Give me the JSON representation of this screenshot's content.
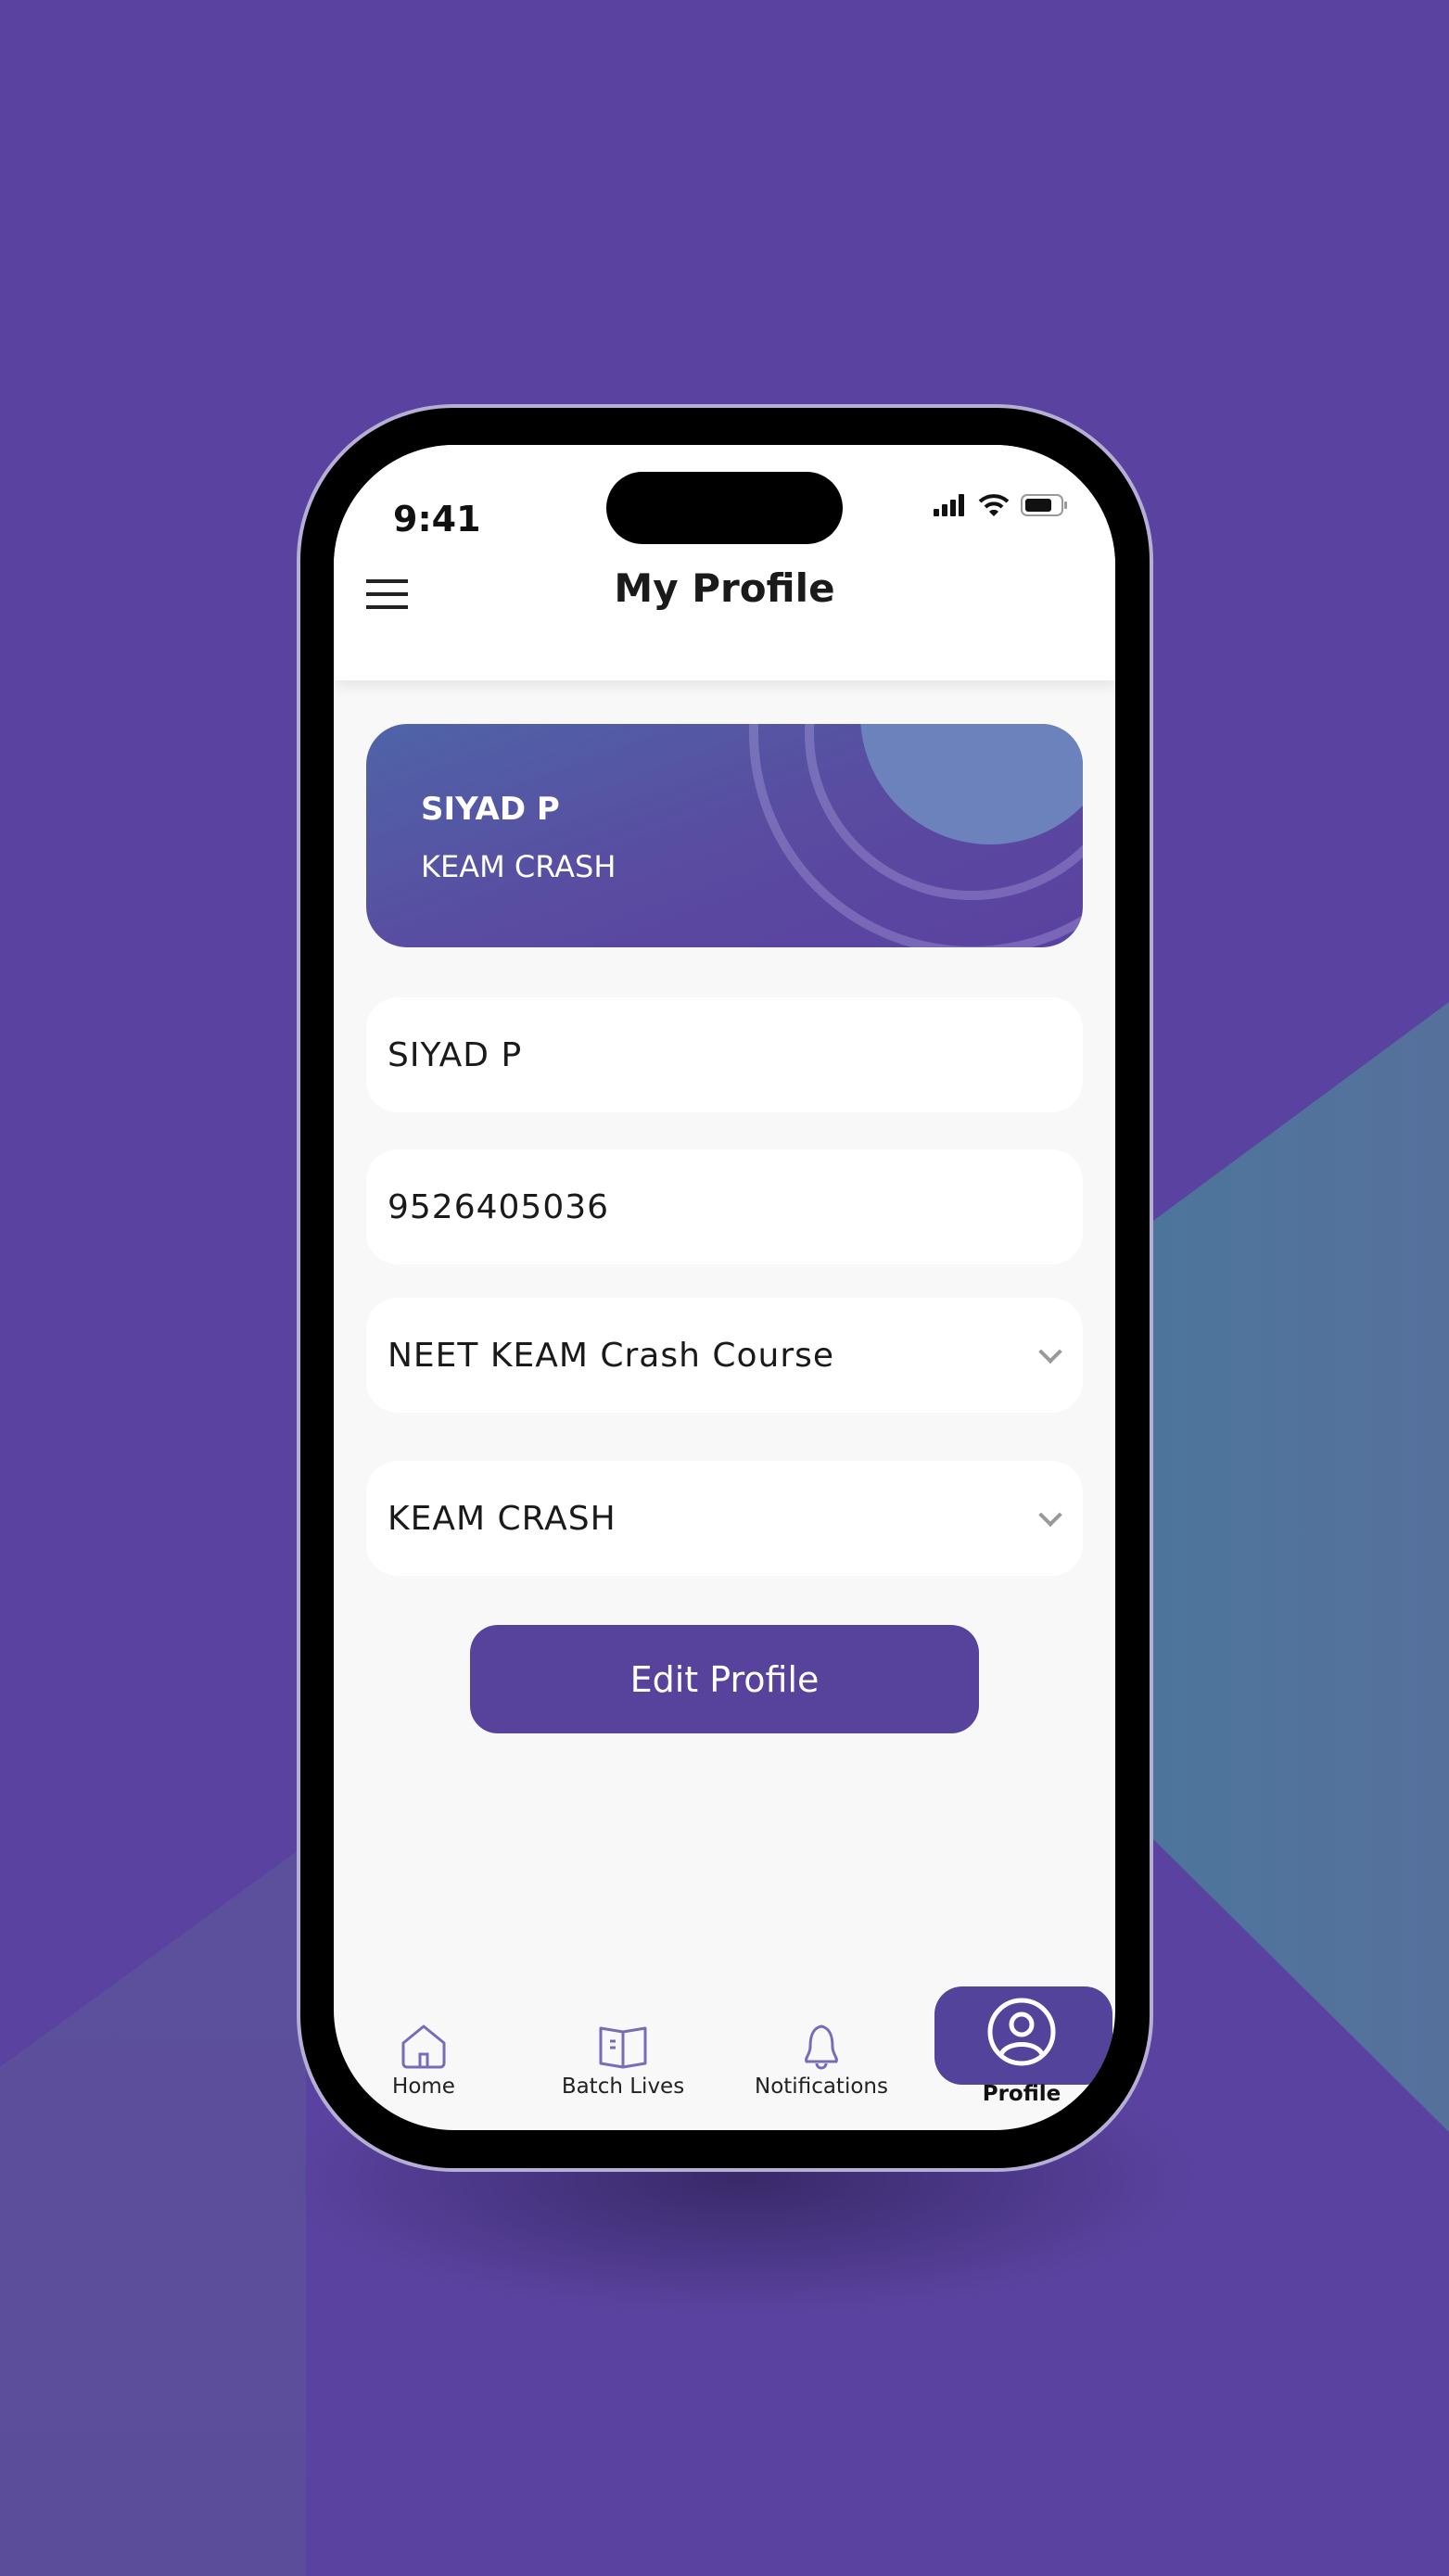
{
  "status_bar": {
    "time": "9:41"
  },
  "header": {
    "title": "My Profile",
    "menu_icon": "hamburger-icon"
  },
  "profile_card": {
    "name": "SIYAD P",
    "course": "KEAM CRASH"
  },
  "form": {
    "name_value": "SIYAD P",
    "phone_value": "9526405036",
    "program_select": "NEET KEAM Crash Course",
    "batch_select": "KEAM CRASH"
  },
  "edit_button": "Edit Profile",
  "bottom_nav": {
    "items": [
      {
        "label": "Home",
        "icon": "home-icon"
      },
      {
        "label": "Batch Lives",
        "icon": "book-icon"
      },
      {
        "label": "Notifications",
        "icon": "bell-icon"
      },
      {
        "label": "Profile",
        "icon": "user-circle-icon",
        "active": true
      }
    ]
  },
  "colors": {
    "brand": "#57439c",
    "background": "#5a43a0",
    "teal": "#3b7f9b"
  }
}
